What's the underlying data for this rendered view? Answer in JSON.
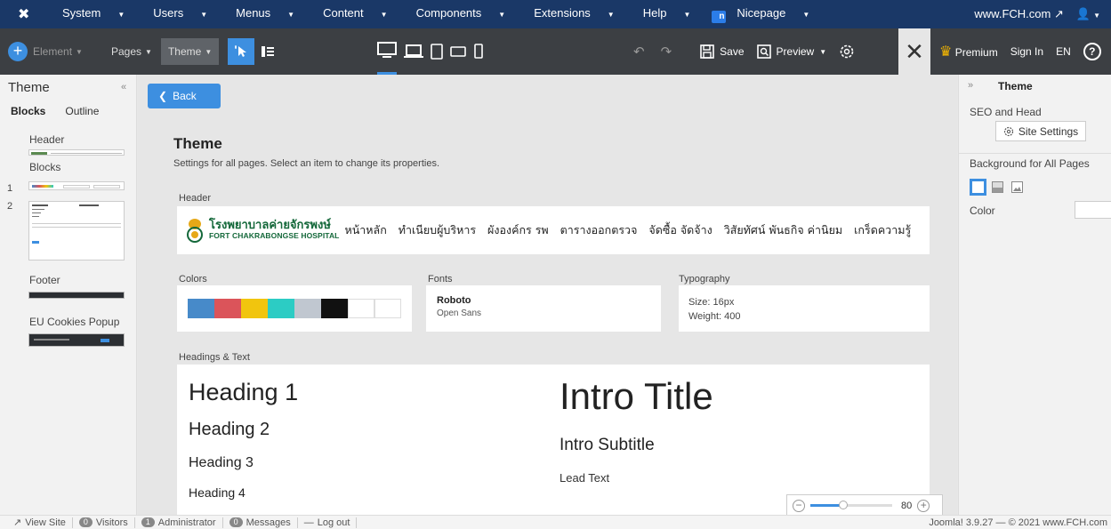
{
  "joomla_bar": {
    "menu": [
      "System",
      "Users",
      "Menus",
      "Content",
      "Components",
      "Extensions",
      "Help"
    ],
    "nicepage": "Nicepage",
    "site": "www.FCH.com"
  },
  "toolbar": {
    "element": "Element",
    "pages": "Pages",
    "theme": "Theme",
    "save": "Save",
    "preview": "Preview",
    "premium": "Premium",
    "sign_in": "Sign In",
    "lang": "EN",
    "help": "?"
  },
  "left_panel": {
    "title": "Theme",
    "tabs": [
      "Blocks",
      "Outline"
    ],
    "header": "Header",
    "blocks": "Blocks",
    "block_numbers": [
      "1",
      "2"
    ],
    "footer": "Footer",
    "cookies": "EU Cookies Popup"
  },
  "canvas": {
    "back": "Back",
    "title": "Theme",
    "subtitle": "Settings for all pages. Select an item to change its properties.",
    "header_label": "Header",
    "logo_th": "โรงพยาบาลค่ายจักรพงษ์",
    "logo_en": "FORT CHAKRABONGSE HOSPITAL",
    "nav": [
      "หน้าหลัก",
      "ทำเนียบผู้บริหาร",
      "ผังองค์กร รพ",
      "ตารางออกตรวจ",
      "จัดซื้อ จัดจ้าง",
      "วิสัยทัศน์ พันธกิจ ค่านิยม",
      "เกร็ดความรู้"
    ],
    "colors_label": "Colors",
    "colors": [
      "#478ac9",
      "#db545a",
      "#f1c50e",
      "#2cccc4",
      "#c0c7d0",
      "#111111",
      "#ffffff",
      "#ffffff"
    ],
    "fonts_label": "Fonts",
    "font_primary": "Roboto",
    "font_secondary": "Open Sans",
    "typography_label": "Typography",
    "typo_size": "Size: 16px",
    "typo_weight": "Weight: 400",
    "headings_label": "Headings & Text",
    "h1": "Heading 1",
    "h2": "Heading 2",
    "h3": "Heading 3",
    "h4": "Heading 4",
    "intro_title": "Intro Title",
    "intro_subtitle": "Intro Subtitle",
    "lead": "Lead Text",
    "zoom": 80
  },
  "right_panel": {
    "title": "Theme",
    "seo": "SEO and Head",
    "site_settings": "Site Settings",
    "bg_all": "Background for All Pages",
    "color": "Color"
  },
  "status_bar": {
    "view_site": "View Site",
    "visitors_count": "0",
    "visitors": "Visitors",
    "admin_count": "1",
    "admin": "Administrator",
    "messages_count": "0",
    "messages": "Messages",
    "logout": "Log out",
    "version": "Joomla! 3.9.27 — © 2021 www.FCH.com"
  },
  "accent_color": "#3d8fe0"
}
